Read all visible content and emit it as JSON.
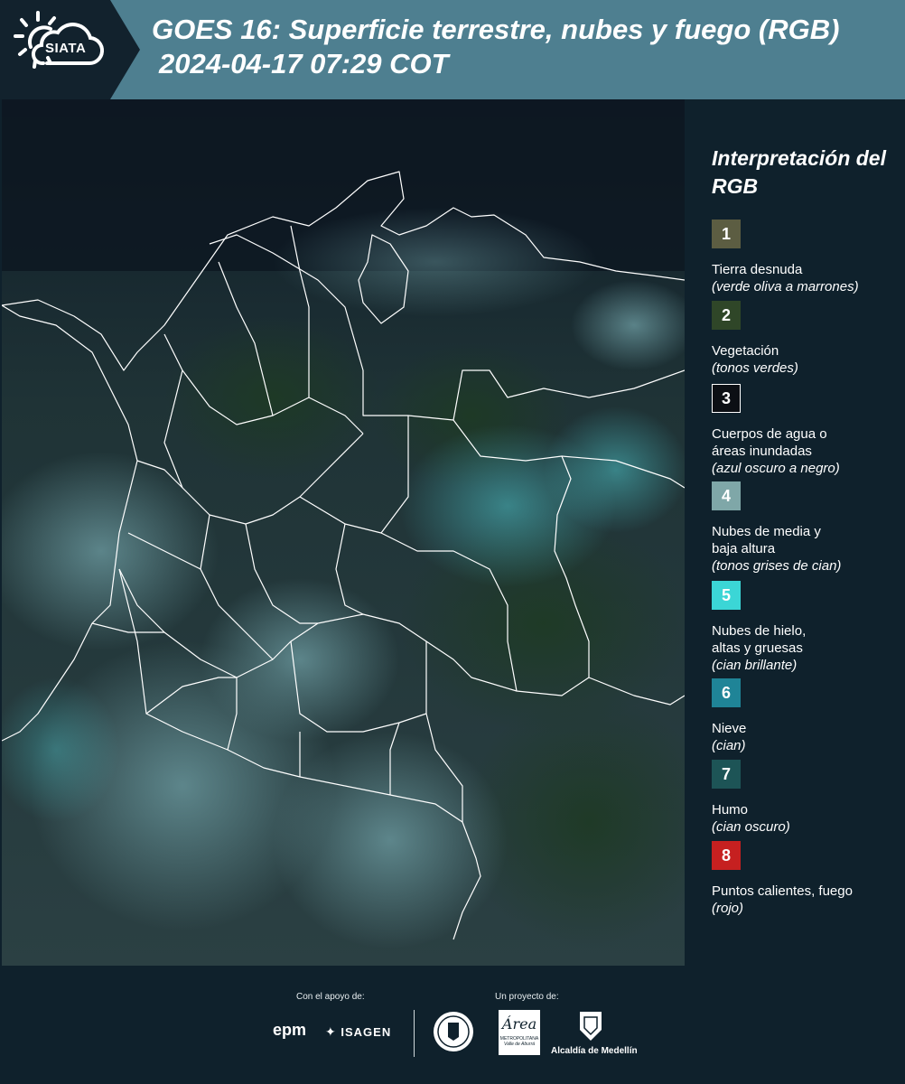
{
  "header": {
    "logo_text": "SIATA",
    "title": "GOES 16: Superficie terrestre, nubes y fuego (RGB)",
    "subtitle": "2024-04-17 07:29 COT"
  },
  "legend": {
    "title": "Interpretación del RGB",
    "items": [
      {
        "number": "1",
        "label": "Tierra desnuda",
        "note": "(verde oliva a marrones)",
        "color": "#5c5d42"
      },
      {
        "number": "2",
        "label": "Vegetación",
        "note": "(tonos verdes)",
        "color": "#2f4628"
      },
      {
        "number": "3",
        "label": "Cuerpos de agua o áreas inundadas",
        "note": "(azul oscuro a negro)",
        "color": "#0c0f14"
      },
      {
        "number": "4",
        "label": "Nubes de media y baja altura",
        "note": "(tonos grises de cian)",
        "color": "#7fa7a8"
      },
      {
        "number": "5",
        "label": "Nubes de hielo, altas y gruesas",
        "note": "(cian brillante)",
        "color": "#3bd6d6"
      },
      {
        "number": "6",
        "label": "Nieve",
        "note": "(cian)",
        "color": "#1f8497"
      },
      {
        "number": "7",
        "label": "Humo",
        "note": "(cian oscuro)",
        "color": "#1d5456"
      },
      {
        "number": "8",
        "label": "Puntos calientes, fuego",
        "note": "(rojo)",
        "color": "#c62020"
      }
    ]
  },
  "footer": {
    "support_label": "Con el apoyo de:",
    "project_label": "Un proyecto de:",
    "sponsors": {
      "epm": "epm",
      "isagen": "ISAGEN",
      "area_metro": "Área",
      "area_metro_sub": "METROPOLITANA",
      "area_metro_sub2": "Valle de Aburrá",
      "alcaldia": "Alcaldía de Medellín"
    }
  }
}
